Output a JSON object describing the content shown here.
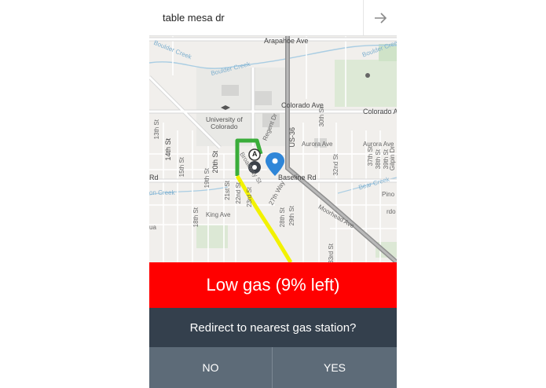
{
  "search": {
    "value": "table mesa dr",
    "go_icon": "arrow-right-icon"
  },
  "map": {
    "labels": {
      "arapahoe": "Arapahoe Ave",
      "boulder_creek_1": "Boulder Creek",
      "boulder_creek_2": "Boulder Creek",
      "boulder_creek_3": "Boulder Creek",
      "university": "University of\nColorado",
      "regent": "Regent Dr",
      "colorado_ave_1": "Colorado Ave",
      "colorado_ave_2": "Colorado Ave",
      "aurora_1": "Aurora Ave",
      "aurora_2": "Aurora Ave",
      "us36": "US-36",
      "baseline": "Baseline Rd",
      "rd_left": "Rd",
      "broadway": "Broadway St",
      "way27": "27th Way",
      "moorhead": "Moorhead Ave",
      "king": "King Ave",
      "st20": "20th St",
      "st19": "19th St",
      "st18": "18th St",
      "st15": "15th St",
      "st13": "13th St",
      "st14": "14th St",
      "st21": "21st St",
      "st22": "22nd St",
      "st23": "23rd St",
      "st28": "28th St",
      "st29": "29th St",
      "st30": "30th St",
      "st32": "32nd St",
      "st33": "33rd St",
      "st37": "37th St",
      "st38": "38th St",
      "st39": "39th St",
      "gilpin": "Gilpin Dr",
      "pino": "Pino",
      "rdo": "rdo",
      "ua": "ua",
      "creek_left": "on Creek",
      "bear_creek": "Bear Creek",
      "marker_a": "A"
    },
    "route_color": "#f2f200",
    "route_start_color": "#3aad3a",
    "pin_color": "#2f86d8"
  },
  "alert": {
    "text": "Low gas (9% left)",
    "color": "#ff0000"
  },
  "prompt": {
    "text": "Redirect to nearest gas station?"
  },
  "buttons": {
    "no": "NO",
    "yes": "YES"
  }
}
